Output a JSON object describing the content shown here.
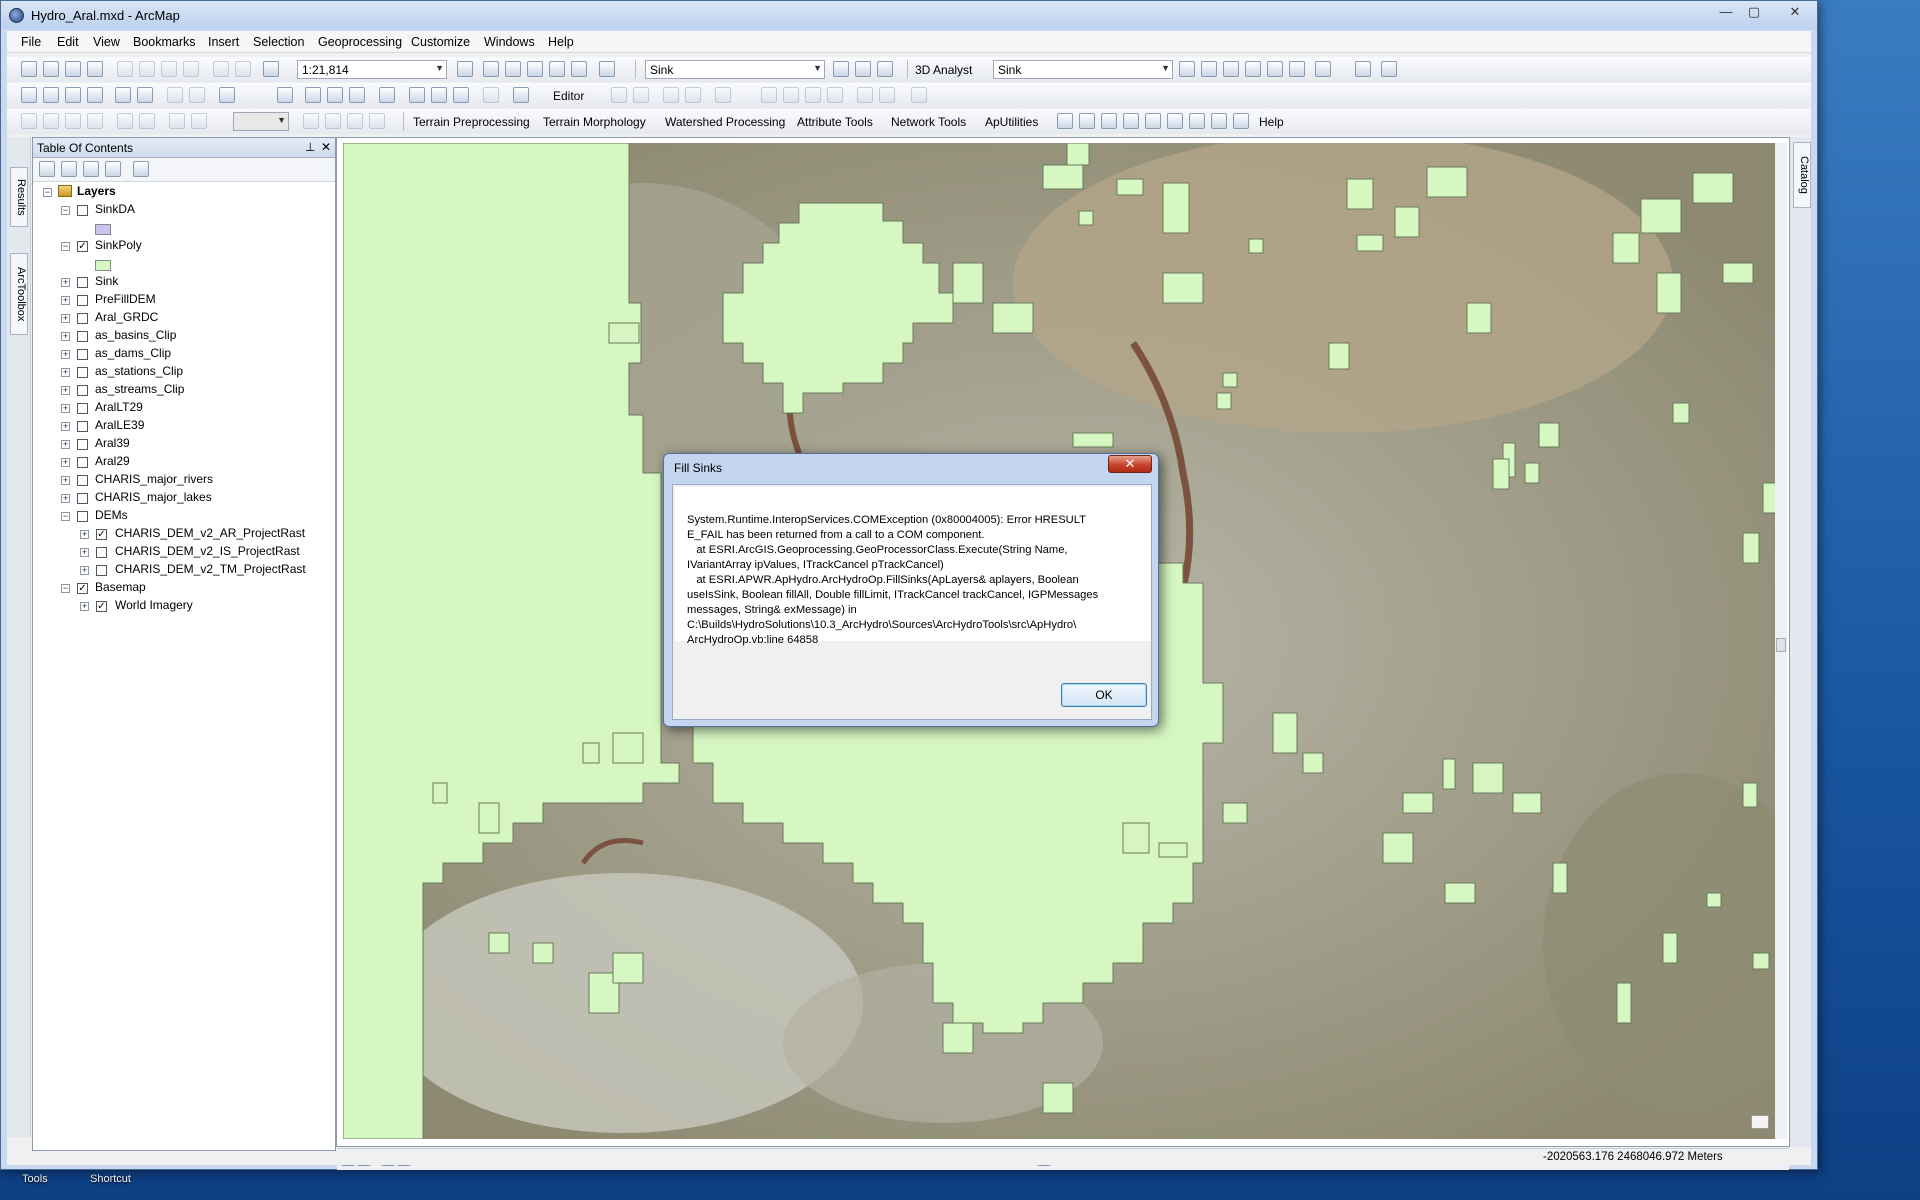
{
  "window": {
    "title": "Hydro_Aral.mxd - ArcMap",
    "controls": {
      "minimize": "—",
      "maximize": "▢",
      "close": "✕"
    }
  },
  "menu": [
    "File",
    "Edit",
    "View",
    "Bookmarks",
    "Insert",
    "Selection",
    "Geoprocessing",
    "Customize",
    "Windows",
    "Help"
  ],
  "toolbar1": {
    "scale": "1:21,814",
    "layer_select": "Sink",
    "analyst_label": "3D Analyst",
    "analyst_layer": "Sink"
  },
  "toolbar2": {
    "editor_label": "Editor"
  },
  "toolbar3": {
    "menus": [
      "Terrain Preprocessing",
      "Terrain Morphology",
      "Watershed Processing",
      "Attribute Tools",
      "Network Tools",
      "ApUtilities"
    ],
    "help_label": "Help"
  },
  "side_tabs": {
    "results": "Results",
    "arctoolbox": "ArcToolbox",
    "catalog": "Catalog"
  },
  "toc": {
    "title": "Table Of Contents",
    "pin": "⊥",
    "close": "✕",
    "layers": {
      "root": "Layers",
      "sinkda": "SinkDA",
      "sinkpoly": "SinkPoly",
      "sink": "Sink",
      "prefilldem": "PreFillDEM",
      "aral_grdc": "Aral_GRDC",
      "basins": "as_basins_Clip",
      "dams": "as_dams_Clip",
      "stations": "as_stations_Clip",
      "streams": "as_streams_Clip",
      "arallt29": "AralLT29",
      "aralle39": "AralLE39",
      "aral39": "Aral39",
      "aral29": "Aral29",
      "rivers": "CHARIS_major_rivers",
      "lakes": "CHARIS_major_lakes",
      "dems": "DEMs",
      "dem_ar": "CHARIS_DEM_v2_AR_ProjectRast",
      "dem_is": "CHARIS_DEM_v2_IS_ProjectRast",
      "dem_tm": "CHARIS_DEM_v2_TM_ProjectRast",
      "basemap": "Basemap",
      "imagery": "World Imagery"
    },
    "colors": {
      "sinkda": "#c8c4ec",
      "sinkpoly": "#d6f7c2"
    }
  },
  "dialog": {
    "title": "Fill Sinks",
    "close_glyph": "✕",
    "message": "System.Runtime.InteropServices.COMException (0x80004005): Error HRESULT\nE_FAIL has been returned from a call to a COM component.\n   at ESRI.ArcGIS.Geoprocessing.GeoProcessorClass.Execute(String Name,\nIVariantArray ipValues, ITrackCancel pTrackCancel)\n   at ESRI.APWR.ApHydro.ArcHydroOp.FillSinks(ApLayers& aplayers, Boolean\nuseIsSink, Boolean fillAll, Double fillLimit, ITrackCancel trackCancel, IGPMessages\nmessages, String& exMessage) in\nC:\\Builds\\HydroSolutions\\10.3_ArcHydro\\Sources\\ArcHydroTools\\src\\ApHydro\\\nArcHydroOp.vb:line 64858",
    "ok_label": "OK"
  },
  "status": {
    "coordinates": "-2020563.176  2468046.972 Meters"
  },
  "desktop": {
    "label1": "Tools",
    "label2": "Shortcut"
  },
  "colors": {
    "polygon_fill": "#d6f7c2",
    "title_bar": "#c9daf0",
    "accent": "#3c7fb1"
  }
}
